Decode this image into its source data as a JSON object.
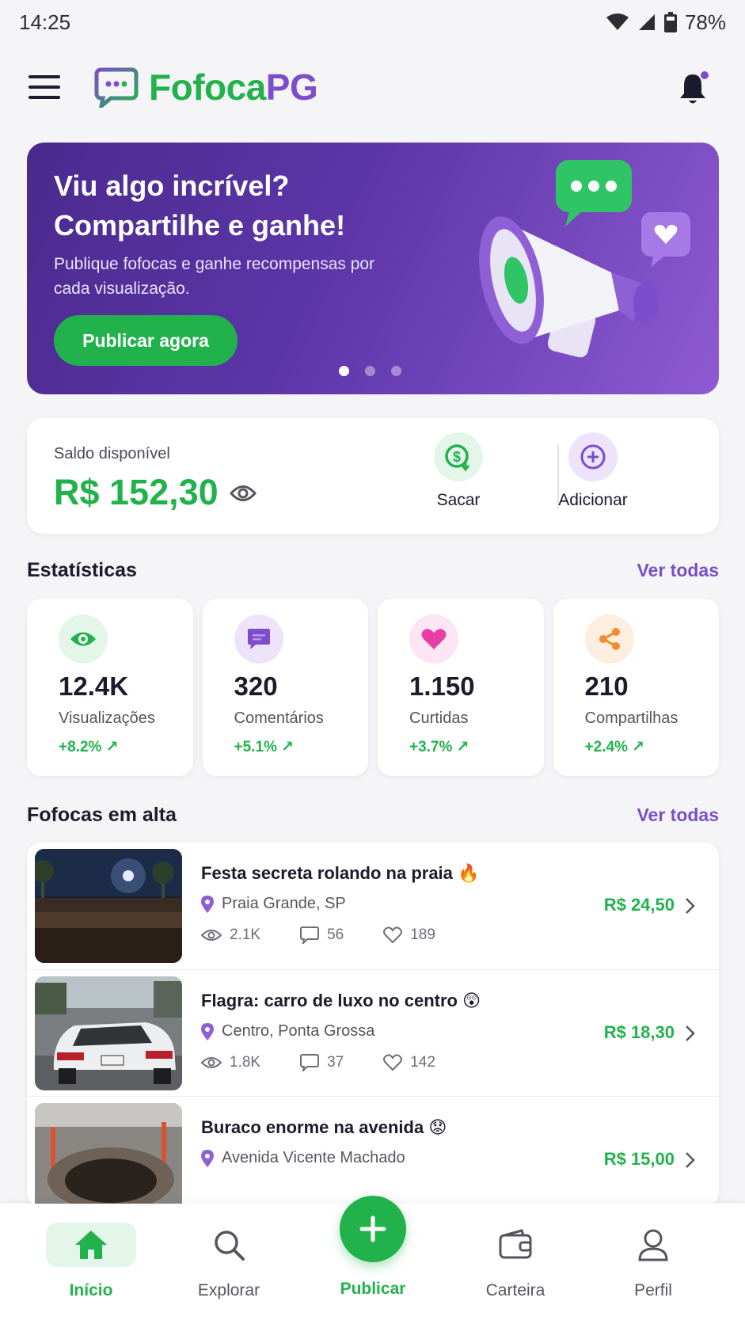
{
  "status_bar": {
    "time": "14:25",
    "battery": "78%"
  },
  "app": {
    "name_part1": "Fofoca",
    "name_part2": "PG"
  },
  "banner": {
    "title_line1": "Viu algo incrível?",
    "title_line2": "Compartilhe e ganhe!",
    "subtitle": "Publique fofocas e ganhe recompensas por cada visualização.",
    "cta": "Publicar agora",
    "slide_count": 3,
    "active_slide": 1
  },
  "balance": {
    "label": "Saldo disponível",
    "value": "R$ 152,30",
    "withdraw_label": "Sacar",
    "add_label": "Adicionar"
  },
  "stats_section": {
    "title": "Estatísticas",
    "see_all": "Ver todas",
    "items": [
      {
        "value": "12.4K",
        "label": "Visualizações",
        "delta": "+8.2% ↗",
        "icon": "eye-icon",
        "color": "#22b24c",
        "bg": "#e4f6e9"
      },
      {
        "value": "320",
        "label": "Comentários",
        "delta": "+5.1% ↗",
        "icon": "comment-icon",
        "color": "#7c4dcc",
        "bg": "#ede4fb"
      },
      {
        "value": "1.150",
        "label": "Curtidas",
        "delta": "+3.7% ↗",
        "icon": "heart-icon",
        "color": "#e83fa6",
        "bg": "#fde6f3"
      },
      {
        "value": "210",
        "label": "Compartilhas",
        "delta": "+2.4% ↗",
        "icon": "share-icon",
        "color": "#f28a2e",
        "bg": "#fdeedf"
      }
    ]
  },
  "trending": {
    "title": "Fofocas em alta",
    "see_all": "Ver todas",
    "posts": [
      {
        "title": "Festa secreta rolando na praia 🔥",
        "location": "Praia Grande, SP",
        "views": "2.1K",
        "comments": "56",
        "likes": "189",
        "price": "R$ 24,50"
      },
      {
        "title": "Flagra: carro de luxo no centro 😲",
        "location": "Centro, Ponta Grossa",
        "views": "1.8K",
        "comments": "37",
        "likes": "142",
        "price": "R$ 18,30"
      },
      {
        "title": "Buraco enorme na avenida 😟",
        "location": "Avenida Vicente Machado",
        "price": "R$ 15,00"
      }
    ]
  },
  "nav": {
    "home": "Início",
    "explore": "Explorar",
    "publish": "Publicar",
    "wallet": "Carteira",
    "profile": "Perfil",
    "active": "home"
  },
  "colors": {
    "green": "#22b24c",
    "purple": "#7c4dcc"
  }
}
